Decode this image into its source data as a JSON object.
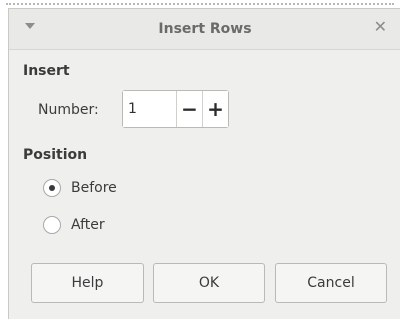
{
  "dialog": {
    "title": "Insert Rows",
    "menu_icon": "chevron-down-icon",
    "close_icon": "close-icon",
    "close_glyph": "✕"
  },
  "insert": {
    "section_label": "Insert",
    "number_label": "Number:",
    "number_value": "1",
    "decrement_label": "−",
    "increment_label": "+"
  },
  "position": {
    "section_label": "Position",
    "options": [
      {
        "label": "Before",
        "selected": true
      },
      {
        "label": "After",
        "selected": false
      }
    ]
  },
  "buttons": {
    "help": "Help",
    "ok": "OK",
    "cancel": "Cancel"
  }
}
